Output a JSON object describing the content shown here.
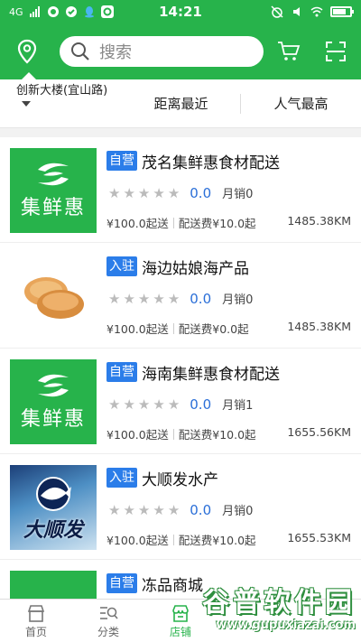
{
  "status_bar": {
    "network": "4G",
    "time": "14:21",
    "colors": {
      "bar": "#27b34b"
    }
  },
  "search": {
    "placeholder": "搜索"
  },
  "filters": {
    "location": "创新大楼(宜山路)",
    "nearest": "距离最近",
    "popular": "人气最高"
  },
  "stores": [
    {
      "badge": "自营",
      "name": "茂名集鲜惠食材配送",
      "score": "0.0",
      "sales": "月销0",
      "min_order": "¥100.0起送",
      "delivery_fee": "配送费¥10.0起",
      "distance": "1485.38KM",
      "logo": "jixianhui-logo",
      "logo_text": "集鲜惠"
    },
    {
      "badge": "入驻",
      "name": "海边姑娘海产品",
      "score": "0.0",
      "sales": "月销0",
      "min_order": "¥100.0起送",
      "delivery_fee": "配送费¥0.0起",
      "distance": "1485.38KM",
      "logo": "shell-photo",
      "logo_text": ""
    },
    {
      "badge": "自营",
      "name": "海南集鲜惠食材配送",
      "score": "0.0",
      "sales": "月销1",
      "min_order": "¥100.0起送",
      "delivery_fee": "配送费¥10.0起",
      "distance": "1655.56KM",
      "logo": "jixianhui-logo",
      "logo_text": "集鲜惠"
    },
    {
      "badge": "入驻",
      "name": "大顺发水产",
      "score": "0.0",
      "sales": "月销0",
      "min_order": "¥100.0起送",
      "delivery_fee": "配送费¥10.0起",
      "distance": "1655.53KM",
      "logo": "dashunfa-logo",
      "logo_text": "大顺发"
    },
    {
      "badge": "自营",
      "name": "冻品商城",
      "logo": "jixianhui-logo"
    }
  ],
  "bottom_nav": [
    {
      "label": "首页",
      "icon": "home-icon"
    },
    {
      "label": "分类",
      "icon": "category-icon"
    },
    {
      "label": "店铺",
      "icon": "store-icon",
      "active": true
    }
  ],
  "watermark": {
    "title": "谷普软件园",
    "url": "www.gupuxiazai.com"
  }
}
